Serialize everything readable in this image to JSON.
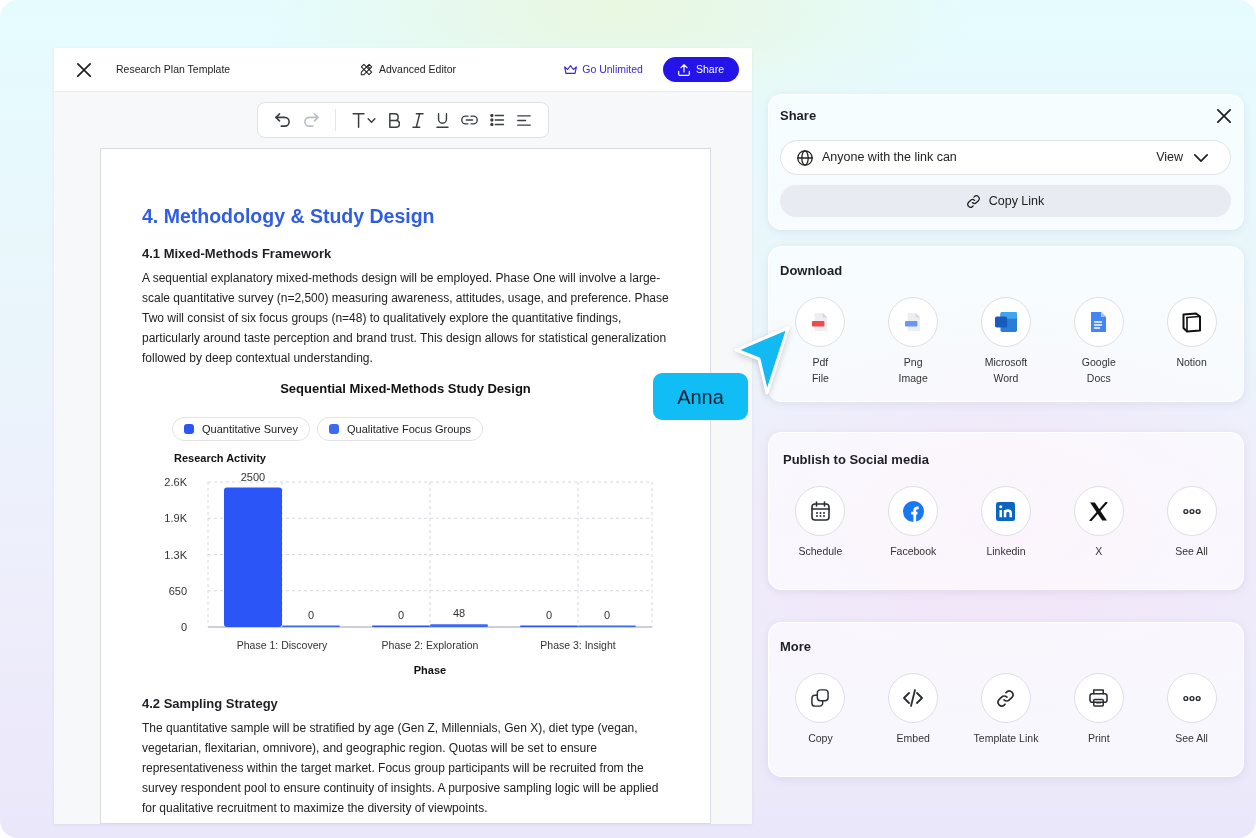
{
  "editor": {
    "title": "Research Plan Template",
    "mode_button": "Advanced Editor",
    "upgrade_link": "Go Unlimited",
    "share_button": "Share",
    "toolbar_groups": [
      {
        "tools": [
          {
            "kind": "undo",
            "disabled": false
          },
          {
            "kind": "redo",
            "disabled": true
          }
        ]
      },
      {
        "tools": [
          {
            "kind": "text_style",
            "disabled": false
          },
          {
            "kind": "bold",
            "disabled": false
          },
          {
            "kind": "italic",
            "disabled": false
          },
          {
            "kind": "underline",
            "disabled": false
          },
          {
            "kind": "link",
            "disabled": false
          },
          {
            "kind": "bullet_list",
            "disabled": false
          },
          {
            "kind": "align_left",
            "disabled": false
          }
        ]
      }
    ],
    "document": {
      "heading": "4. Methodology & Study Design",
      "blocks": [
        {
          "kind": "subheading",
          "text": "4.1 Mixed-Methods Framework"
        },
        {
          "kind": "paragraph",
          "text": "A sequential explanatory mixed-methods design will be employed. Phase One will involve a large-scale quantitative survey (n=2,500) measuring awareness, attitudes, usage, and preference. Phase Two will consist of six focus groups (n=48) to qualitatively explore the quantitative findings, particularly around taste perception and brand trust. This design allows for statistical generalization followed by deep contextual understanding."
        },
        {
          "kind": "chart",
          "chart_data": {
            "type": "bar",
            "title": "Sequential Mixed-Methods Study Design",
            "xlabel": "Phase",
            "ylabel": "Research Activity",
            "categories": [
              "Phase 1: Discovery",
              "Phase 2: Exploration",
              "Phase 3: Insight"
            ],
            "series": [
              {
                "name": "Quantitative Survey",
                "color": "#2b55f6",
                "values": [
                  2500,
                  0,
                  0
                ]
              },
              {
                "name": "Qualitative Focus Groups",
                "color": "#3d6af3",
                "values": [
                  0,
                  48,
                  0
                ]
              }
            ],
            "ylim": [
              0,
              2600
            ],
            "yticks": [
              0,
              {
                "value": 650,
                "label": "650"
              },
              {
                "value": 1300,
                "label": "1.3K"
              },
              {
                "value": 1950,
                "label": "1.9K"
              },
              {
                "value": 2600,
                "label": "2.6K"
              }
            ],
            "grid": true,
            "legend": "top",
            "data_labels": true
          }
        },
        {
          "kind": "subheading",
          "text": "4.2 Sampling Strategy"
        },
        {
          "kind": "paragraph",
          "text": "The quantitative sample will be stratified by age (Gen Z, Millennials, Gen X), diet type (vegan, vegetarian, flexitarian, omnivore), and geographic region. Quotas will be set to ensure representativeness within the target market. Focus group participants will be recruited from the survey respondent pool to ensure continuity of insights. A purposive sampling logic will be applied for qualitative recruitment to maximize the diversity of viewpoints."
        }
      ]
    }
  },
  "collaborator_cursor": {
    "name": "Anna"
  },
  "share_panel": {
    "title": "Share",
    "access": {
      "label": "Anyone with the link can",
      "value": "View"
    },
    "copy_button": "Copy Link"
  },
  "download": {
    "title": "Download",
    "options": [
      {
        "kind": "pdf",
        "label": "Pdf File"
      },
      {
        "kind": "png",
        "label": "Png Image"
      },
      {
        "kind": "word",
        "label": "Microsoft Word"
      },
      {
        "kind": "google_docs",
        "label": "Google Docs"
      },
      {
        "kind": "notion",
        "label": "Notion"
      }
    ]
  },
  "publish": {
    "title": "Publish to Social media",
    "options": [
      {
        "kind": "schedule",
        "label": "Schedule"
      },
      {
        "kind": "facebook",
        "label": "Facebook"
      },
      {
        "kind": "linkedin",
        "label": "Linkedin"
      },
      {
        "kind": "x",
        "label": "X"
      },
      {
        "kind": "see_all",
        "label": "See All"
      }
    ]
  },
  "more": {
    "title": "More",
    "options": [
      {
        "kind": "copy",
        "label": "Copy"
      },
      {
        "kind": "embed",
        "label": "Embed"
      },
      {
        "kind": "template_link",
        "label": "Template Link"
      },
      {
        "kind": "print",
        "label": "Print"
      },
      {
        "kind": "see_all",
        "label": "See All"
      }
    ]
  }
}
